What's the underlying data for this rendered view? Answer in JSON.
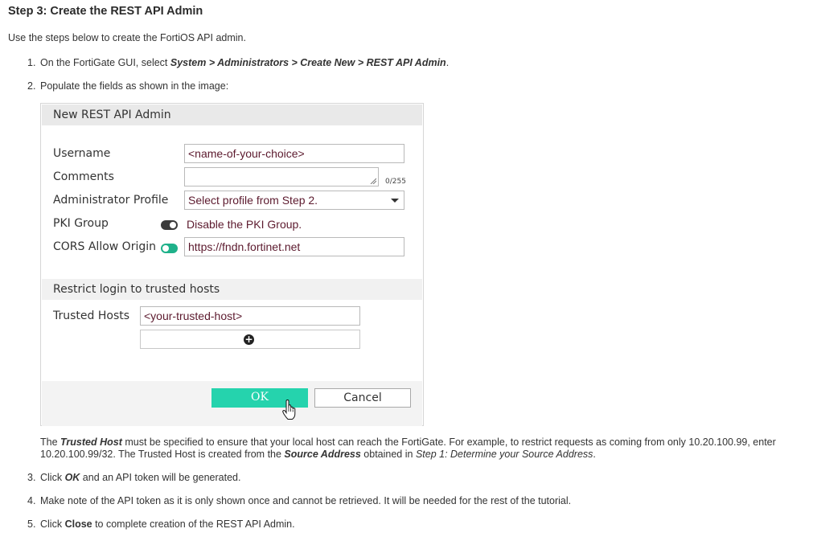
{
  "heading": "Step 3: Create the REST API Admin",
  "intro": "Use the steps below to create the FortiOS API admin.",
  "steps": {
    "s1": {
      "num": "1.",
      "pre": "On the FortiGate GUI, select ",
      "bold": "System > Administrators > Create New > REST API Admin",
      "post": "."
    },
    "s2": {
      "num": "2.",
      "text": "Populate the fields as shown in the image:"
    },
    "s3": {
      "num": "3.",
      "pre": "Click ",
      "bold": "OK",
      "post": " and an API token will be generated."
    },
    "s4": {
      "num": "4.",
      "text": "Make note of the API token as it is only shown once and cannot be retrieved. It will be needed for the rest of the tutorial."
    },
    "s5": {
      "num": "5.",
      "pre": "Click ",
      "bold": "Close",
      "post": " to complete creation of the REST API Admin."
    }
  },
  "dialog": {
    "title": "New REST API Admin",
    "labels": {
      "username": "Username",
      "comments": "Comments",
      "admin_profile": "Administrator Profile",
      "pki_group": "PKI Group",
      "cors": "CORS Allow Origin",
      "trusted_hosts": "Trusted Hosts"
    },
    "values": {
      "username": "<name-of-your-choice>",
      "comments": "",
      "comments_counter": "0/255",
      "admin_profile": "Select profile from Step 2.",
      "pki_group_note": "Disable the PKI Group.",
      "cors": "https://fndn.fortinet.net",
      "trusted_host": "<your-trusted-host>"
    },
    "toggles": {
      "pki_group": false,
      "cors": true
    },
    "section": "Restrict login to trusted hosts",
    "ok_label": "OK",
    "cancel_label": "Cancel",
    "colors": {
      "ok": "#25d3ad",
      "toggle_on": "#1fb18a",
      "value_text": "#5c1a2e"
    }
  },
  "note": {
    "pre": "The ",
    "bi1": "Trusted Host",
    "mid1": " must be specified to ensure that your local host can reach the FortiGate. For example, to restrict requests as coming from only 10.20.100.99, enter 10.20.100.99/32. The Trusted Host is created from the ",
    "bi2": "Source Address",
    "mid2": " obtained in ",
    "it": "Step 1: Determine your Source Address",
    "post": "."
  }
}
